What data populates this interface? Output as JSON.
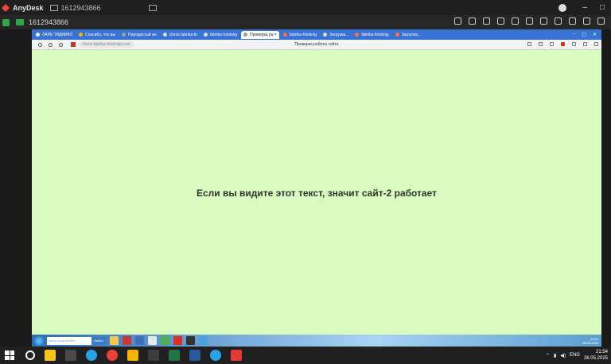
{
  "anydesk": {
    "app_name": "AnyDesk",
    "tab_id": "1612943866",
    "remote_id": "1612943866",
    "win_controls": [
      "–",
      "□"
    ]
  },
  "browser": {
    "tabs": [
      {
        "label": "ЛАРЕ ТВДИИКО",
        "color": "#ffffff"
      },
      {
        "label": "Спасибо, что вы",
        "color": "#f4b400"
      },
      {
        "label": "Порядистый ин",
        "color": "#9e9e9e"
      },
      {
        "label": "check.fabrika-fo",
        "color": "#e0e0e0"
      },
      {
        "label": "fabrika-fotoknig",
        "color": "#e0e0e0"
      },
      {
        "label": "Проверка ра",
        "color": "#e0e0e0",
        "active": true
      },
      {
        "label": "fabrika-fotoknig",
        "color": "#ff7043"
      },
      {
        "label": "Загрузка...",
        "color": "#e0e0e0"
      },
      {
        "label": "fabrika-fotoknig",
        "color": "#ff7043"
      },
      {
        "label": "Загрузка...",
        "color": "#ff7043"
      }
    ],
    "url": "check.fabrika-fotoknigi.com",
    "page_title": "Проверка работы сайта"
  },
  "page": {
    "message": "Если вы видите этот текст, значит сайт-2 работает"
  },
  "remote_taskbar": {
    "search_placeholder": "поиск в интернете",
    "search_button": "Найти",
    "clock": "22:54",
    "date": "26.05.2025",
    "apps": [
      "#f2c94c",
      "#c83737",
      "#3d6fb6",
      "#e8e8e8",
      "#4caf50",
      "#d93025",
      "#333333",
      "#4aa3df"
    ]
  },
  "windows_taskbar": {
    "apps": [
      "#f5c518",
      "#4a4a4a",
      "#2aa3e6",
      "#ea4335",
      "#f5b400",
      "#3c3c3c",
      "#217346",
      "#2b579a",
      "#2aa3e6",
      "#e53935"
    ],
    "language": "ENG",
    "time": "21:54",
    "date": "26.05.2025"
  }
}
